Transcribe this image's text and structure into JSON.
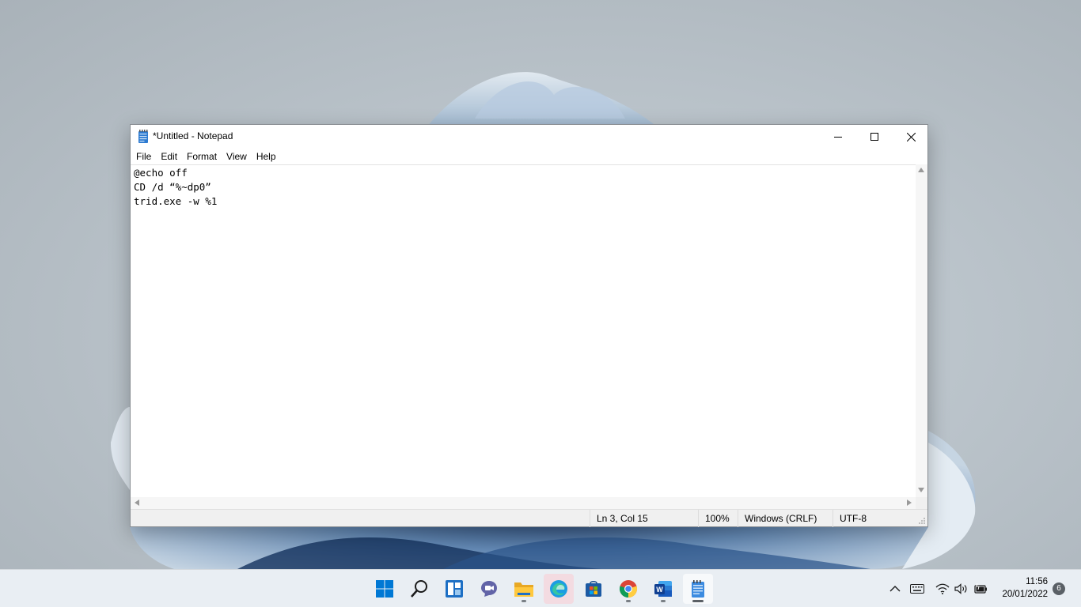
{
  "window": {
    "title": "*Untitled - Notepad",
    "app": "Notepad"
  },
  "menu": [
    "File",
    "Edit",
    "Format",
    "View",
    "Help"
  ],
  "editor": {
    "lines": [
      "@echo off",
      "CD /d “%~dp0”",
      "trid.exe -w %1"
    ]
  },
  "status": {
    "position": "Ln 3, Col 15",
    "zoom": "100%",
    "line_ending": "Windows (CRLF)",
    "encoding": "UTF-8"
  },
  "taskbar": {
    "apps": [
      "start-icon",
      "search-icon",
      "widgets-icon",
      "teams-chat-icon",
      "file-explorer-icon",
      "edge-icon",
      "microsoft-store-icon",
      "chrome-icon",
      "word-icon",
      "notepad-icon"
    ],
    "tray": [
      "chevron-up-icon",
      "keyboard-icon",
      "wifi-icon",
      "volume-icon",
      "battery-icon"
    ],
    "time": "11:56",
    "date": "20/01/2022",
    "notification_count": "6"
  },
  "colors": {
    "accent": "#0067c0",
    "taskbar_bg": "#e9eef3"
  }
}
